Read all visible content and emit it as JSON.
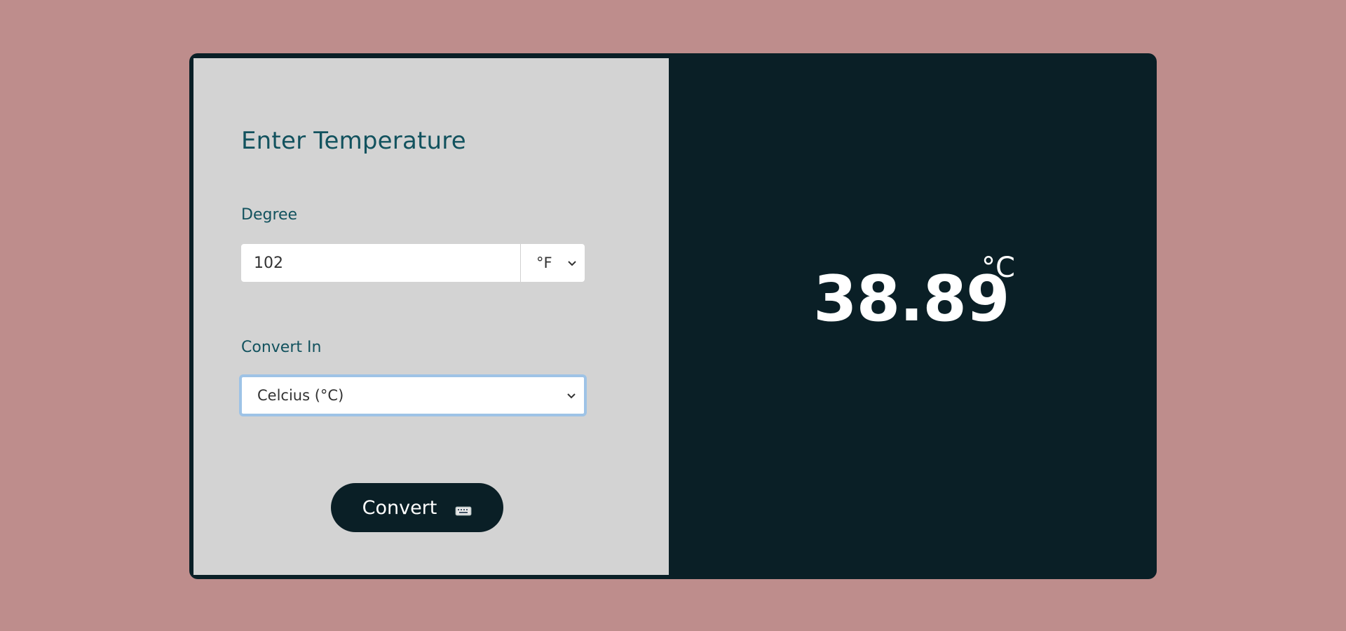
{
  "form": {
    "title": "Enter Temperature",
    "degree_label": "Degree",
    "degree_value": "102",
    "degree_unit": "°F",
    "convert_label": "Convert In",
    "convert_target": "Celcius (°C)",
    "convert_button": "Convert",
    "convert_button_icon": "keyboard-icon"
  },
  "result": {
    "value": "38.89",
    "unit": "°C"
  },
  "colors": {
    "page_background": "#be8d8c",
    "panel_dark": "#0a1f26",
    "panel_light": "#d3d3d3",
    "label_teal": "#12525e",
    "focus_ring": "#9ec3e6"
  }
}
